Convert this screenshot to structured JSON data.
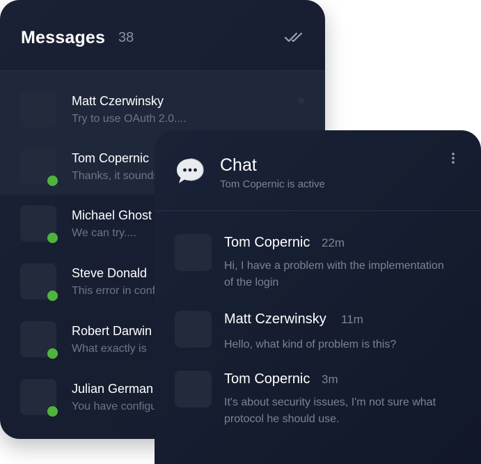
{
  "messages": {
    "title": "Messages",
    "count": "38",
    "items": [
      {
        "name": "Matt Czerwinsky",
        "preview": "Try to use OAuth 2.0....",
        "online": false,
        "active": true,
        "unread": true
      },
      {
        "name": "Tom Copernic",
        "preview": "Thanks, it sounds",
        "online": true,
        "active": true,
        "unread": false
      },
      {
        "name": "Michael Ghost",
        "preview": "We can try....",
        "online": true,
        "active": false,
        "unread": false
      },
      {
        "name": "Steve Donald",
        "preview": "This error in config",
        "online": true,
        "active": false,
        "unread": false
      },
      {
        "name": "Robert Darwin",
        "preview": "What exactly is",
        "online": true,
        "active": false,
        "unread": false
      },
      {
        "name": "Julian German",
        "preview": "You have configured",
        "online": true,
        "active": false,
        "unread": false
      }
    ]
  },
  "chat": {
    "title": "Chat",
    "subtitle": "Tom Copernic is active",
    "messages": [
      {
        "name": "Tom Copernic",
        "time": "22m",
        "text": "Hi, I have a problem with the implementation of the login"
      },
      {
        "name": "Matt Czerwinsky",
        "time": "11m",
        "text": "Hello, what kind of problem is this?"
      },
      {
        "name": "Tom Copernic",
        "time": "3m",
        "text": "It's about security issues, I'm not sure what protocol he should use."
      }
    ]
  },
  "colors": {
    "panel_bg": "#1a2135",
    "online": "#4fb43e",
    "muted_text": "#7c8394",
    "text": "#ffffff"
  },
  "icons": {
    "mark_all_read": "double-check-icon",
    "chat": "chat-bubble-icon",
    "more": "more-vertical-icon"
  }
}
